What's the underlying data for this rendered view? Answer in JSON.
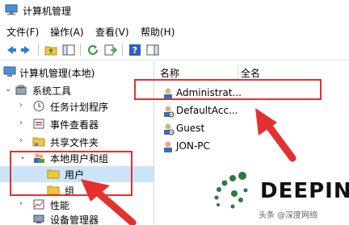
{
  "window": {
    "title": "计算机管理"
  },
  "menu": [
    "文件(F)",
    "操作(A)",
    "查看(V)",
    "帮助(H)"
  ],
  "tree": {
    "root": "计算机管理(本地)",
    "system_tools": "系统工具",
    "task_scheduler": "任务计划程序",
    "event_viewer": "事件查看器",
    "shared_folders": "共享文件夹",
    "local_users_groups": "本地用户和组",
    "users": "用户",
    "groups": "组",
    "performance": "性能",
    "device_manager": "设备管理器"
  },
  "list": {
    "columns": [
      "名称",
      "全名"
    ],
    "rows": [
      "Administrat...",
      "DefaultAcc...",
      "Guest",
      "JON-PC"
    ]
  },
  "watermark": {
    "brand": "DEEPIN",
    "credit": "头条 @深度网络"
  },
  "colors": {
    "callout": "#e53030",
    "accent": "#1a6fc2",
    "folder": "#f2c544"
  }
}
